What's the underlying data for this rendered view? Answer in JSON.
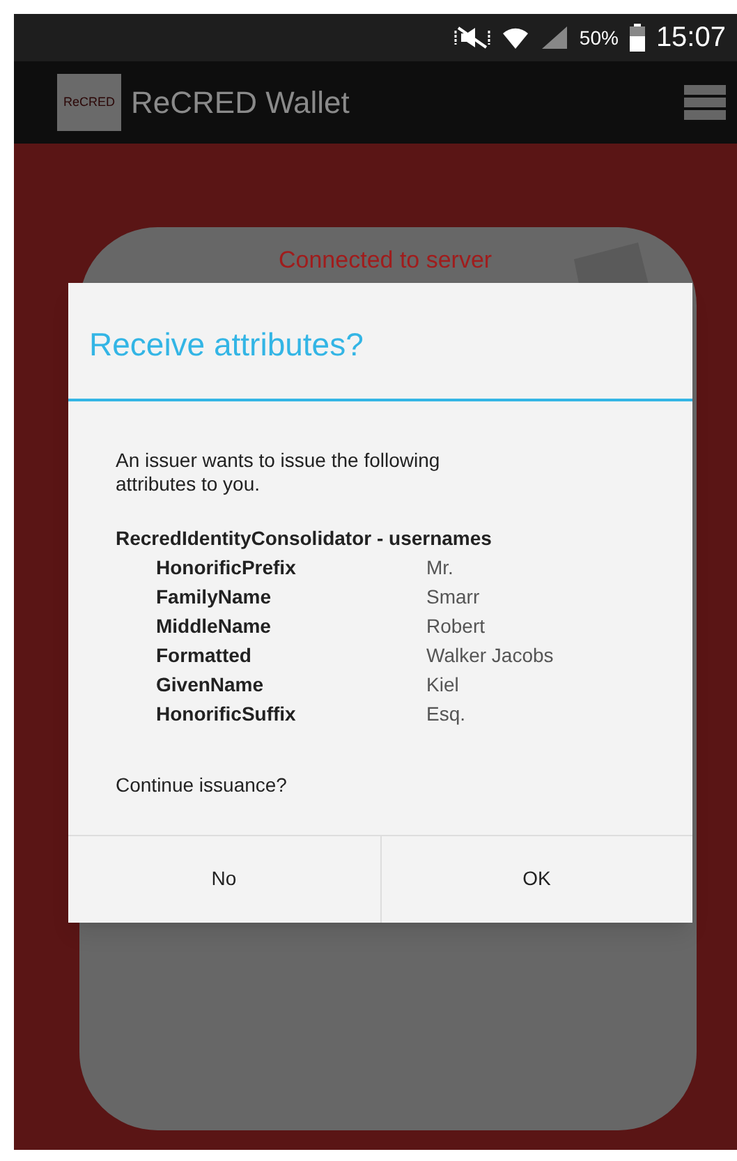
{
  "status_bar": {
    "battery": "50%",
    "time": "15:07"
  },
  "app_bar": {
    "logo": "ReCRED",
    "title": "ReCRED Wallet"
  },
  "card": {
    "status": "Connected to server"
  },
  "dialog": {
    "title": "Receive attributes?",
    "message": "An issuer wants to issue the following attributes to you.",
    "group": "RecredIdentityConsolidator - usernames",
    "attributes": [
      {
        "name": "HonorificPrefix",
        "value": "Mr."
      },
      {
        "name": "FamilyName",
        "value": "Smarr"
      },
      {
        "name": "MiddleName",
        "value": "Robert"
      },
      {
        "name": "Formatted",
        "value": "Walker Jacobs"
      },
      {
        "name": "GivenName",
        "value": "Kiel"
      },
      {
        "name": "HonorificSuffix",
        "value": "Esq."
      }
    ],
    "question": "Continue issuance?",
    "buttons": [
      "No",
      "OK"
    ]
  }
}
